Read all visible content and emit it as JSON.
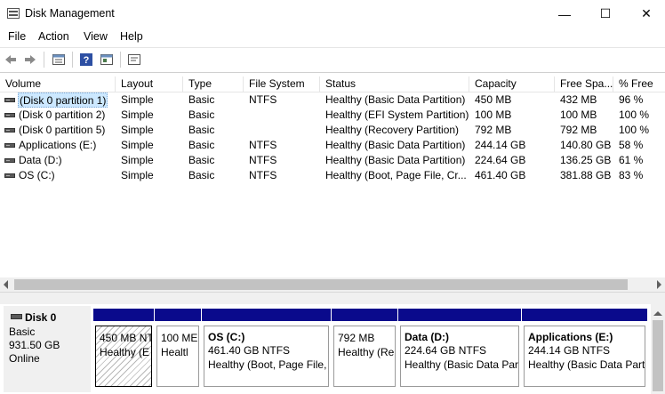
{
  "window": {
    "title": "Disk Management",
    "min_glyph": "—",
    "max_glyph": "☐",
    "close_glyph": "✕"
  },
  "menu": [
    "File",
    "Action",
    "View",
    "Help"
  ],
  "toolbar_icons": [
    "back-icon",
    "forward-icon",
    "list-view-icon",
    "help-icon",
    "properties-icon",
    "console-icon"
  ],
  "columns": [
    "Volume",
    "Layout",
    "Type",
    "File System",
    "Status",
    "Capacity",
    "Free Spa...",
    "% Free"
  ],
  "volumes": [
    {
      "volume": "(Disk 0 partition 1)",
      "layout": "Simple",
      "type": "Basic",
      "fs": "NTFS",
      "status": "Healthy (Basic Data Partition)",
      "capacity": "450 MB",
      "free": "432 MB",
      "pct": "96 %"
    },
    {
      "volume": "(Disk 0 partition 2)",
      "layout": "Simple",
      "type": "Basic",
      "fs": "",
      "status": "Healthy (EFI System Partition)",
      "capacity": "100 MB",
      "free": "100 MB",
      "pct": "100 %"
    },
    {
      "volume": "(Disk 0 partition 5)",
      "layout": "Simple",
      "type": "Basic",
      "fs": "",
      "status": "Healthy (Recovery Partition)",
      "capacity": "792 MB",
      "free": "792 MB",
      "pct": "100 %"
    },
    {
      "volume": "Applications (E:)",
      "layout": "Simple",
      "type": "Basic",
      "fs": "NTFS",
      "status": "Healthy (Basic Data Partition)",
      "capacity": "244.14 GB",
      "free": "140.80 GB",
      "pct": "58 %"
    },
    {
      "volume": "Data (D:)",
      "layout": "Simple",
      "type": "Basic",
      "fs": "NTFS",
      "status": "Healthy (Basic Data Partition)",
      "capacity": "224.64 GB",
      "free": "136.25 GB",
      "pct": "61 %"
    },
    {
      "volume": "OS (C:)",
      "layout": "Simple",
      "type": "Basic",
      "fs": "NTFS",
      "status": "Healthy (Boot, Page File, Cr...",
      "capacity": "461.40 GB",
      "free": "381.88 GB",
      "pct": "83 %"
    }
  ],
  "disk": {
    "name": "Disk 0",
    "type": "Basic",
    "size": "931.50 GB",
    "state": "Online"
  },
  "partitions": [
    {
      "name": "",
      "line1": "450 MB NT",
      "line2": "Healthy (E"
    },
    {
      "name": "",
      "line1": "100 ME",
      "line2": "Healtl"
    },
    {
      "name": "OS  (C:)",
      "line1": "461.40 GB NTFS",
      "line2": "Healthy (Boot, Page File,"
    },
    {
      "name": "",
      "line1": "792 MB",
      "line2": "Healthy (Re"
    },
    {
      "name": "Data  (D:)",
      "line1": "224.64 GB NTFS",
      "line2": "Healthy (Basic Data Par"
    },
    {
      "name": "Applications  (E:)",
      "line1": "244.14 GB NTFS",
      "line2": "Healthy (Basic Data Part"
    }
  ],
  "colors": {
    "partition_bar": "#0a0a8c",
    "selection": "#cce8ff"
  }
}
